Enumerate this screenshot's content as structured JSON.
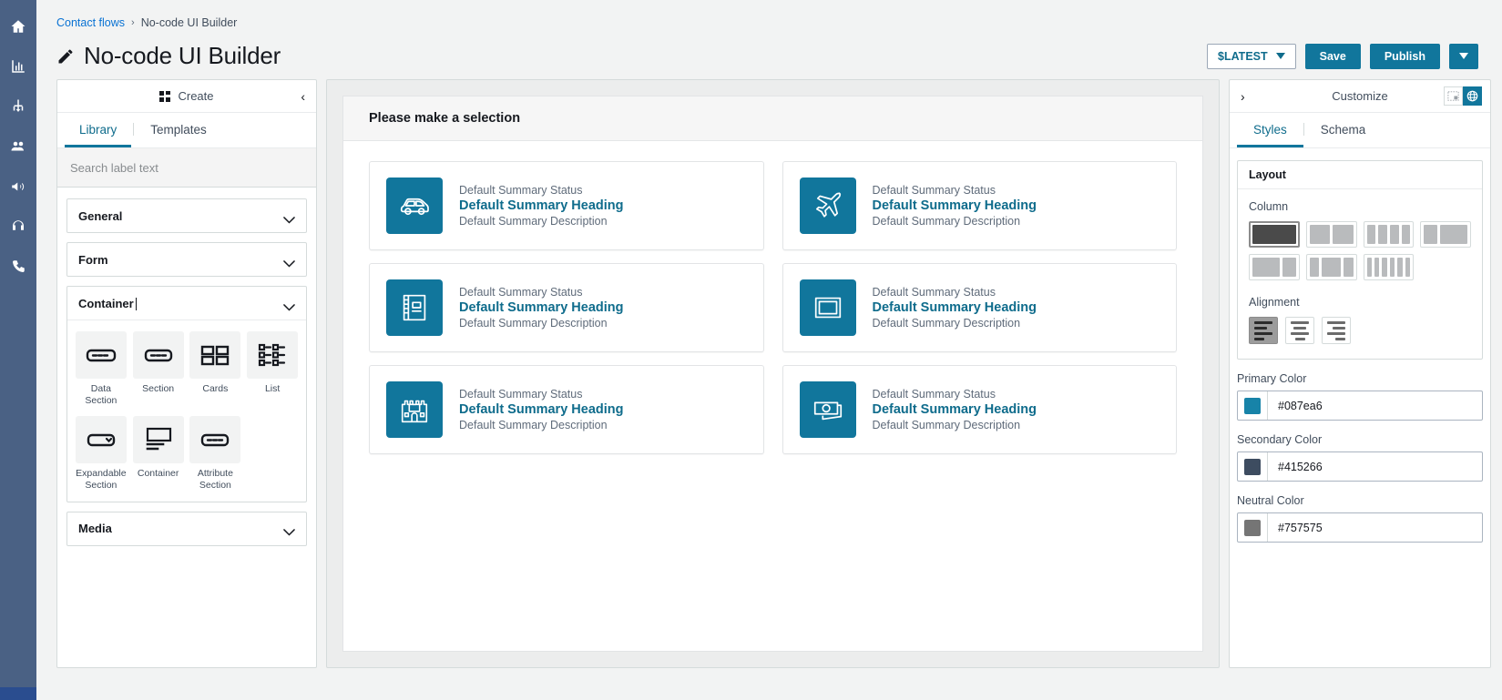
{
  "rail": {
    "items": [
      {
        "name": "home-icon",
        "label": "Home"
      },
      {
        "name": "analytics-icon",
        "label": "Analytics"
      },
      {
        "name": "routing-icon",
        "label": "Routing"
      },
      {
        "name": "users-icon",
        "label": "Users"
      },
      {
        "name": "campaign-icon",
        "label": "Campaigns"
      },
      {
        "name": "headset-icon",
        "label": "Agent workspace"
      },
      {
        "name": "phone-icon",
        "label": "Channels"
      }
    ]
  },
  "header": {
    "breadcrumb": {
      "parent": "Contact flows",
      "separator": "›",
      "current": "No-code UI Builder"
    },
    "title": "No-code UI Builder",
    "version_label": "$LATEST",
    "save_label": "Save",
    "publish_label": "Publish"
  },
  "library": {
    "panel_title": "Create",
    "collapse_icon": "‹",
    "tabs": [
      {
        "label": "Library",
        "active": true
      },
      {
        "label": "Templates",
        "active": false
      }
    ],
    "search": {
      "value": "",
      "placeholder": "Search label text"
    },
    "sections": [
      {
        "label": "General",
        "expanded": false
      },
      {
        "label": "Form",
        "expanded": false
      },
      {
        "label": "Container",
        "expanded": true
      },
      {
        "label": "Media",
        "expanded": false
      }
    ],
    "container_tiles": [
      {
        "label": "Data Section",
        "icon": "data-section-icon"
      },
      {
        "label": "Section",
        "icon": "section-icon"
      },
      {
        "label": "Cards",
        "icon": "cards-icon"
      },
      {
        "label": "List",
        "icon": "list-icon"
      },
      {
        "label": "Expandable Section",
        "icon": "expandable-section-icon"
      },
      {
        "label": "Container",
        "icon": "container-icon"
      },
      {
        "label": "Attribute Section",
        "icon": "attribute-section-icon"
      }
    ]
  },
  "canvas": {
    "selection_title": "Please make a selection",
    "cards": [
      {
        "status": "Default Summary Status",
        "heading": "Default Summary Heading",
        "description": "Default Summary Description",
        "icon": "car-icon"
      },
      {
        "status": "Default Summary Status",
        "heading": "Default Summary Heading",
        "description": "Default Summary Description",
        "icon": "airplane-icon"
      },
      {
        "status": "Default Summary Status",
        "heading": "Default Summary Heading",
        "description": "Default Summary Description",
        "icon": "notebook-icon"
      },
      {
        "status": "Default Summary Status",
        "heading": "Default Summary Heading",
        "description": "Default Summary Description",
        "icon": "window-icon"
      },
      {
        "status": "Default Summary Status",
        "heading": "Default Summary Heading",
        "description": "Default Summary Description",
        "icon": "castle-icon"
      },
      {
        "status": "Default Summary Status",
        "heading": "Default Summary Heading",
        "description": "Default Summary Description",
        "icon": "money-icon"
      }
    ]
  },
  "customize": {
    "panel_title": "Customize",
    "expand_icon": "›",
    "view_toggles": [
      {
        "name": "device-preview-icon",
        "active": false
      },
      {
        "name": "globe-icon",
        "active": true
      }
    ],
    "tabs": [
      {
        "label": "Styles",
        "active": true
      },
      {
        "label": "Schema",
        "active": false
      }
    ],
    "layout": {
      "section_title": "Layout",
      "column_label": "Column",
      "column_options": [
        {
          "name": "column-1",
          "weights": [
            1
          ],
          "active": true
        },
        {
          "name": "column-2-even",
          "weights": [
            1,
            1
          ],
          "active": false
        },
        {
          "name": "column-4-even",
          "weights": [
            1,
            1,
            1,
            1
          ],
          "active": false
        },
        {
          "name": "column-2-wide-right",
          "weights": [
            1,
            2
          ],
          "active": false
        },
        {
          "name": "column-2-wide-left",
          "weights": [
            2,
            1
          ],
          "active": false
        },
        {
          "name": "column-3-center",
          "weights": [
            1,
            2,
            1
          ],
          "active": false
        },
        {
          "name": "column-6-even",
          "weights": [
            1,
            1,
            1,
            1,
            1,
            1
          ],
          "active": false
        }
      ],
      "alignment_label": "Alignment",
      "alignment_options": [
        {
          "name": "align-left",
          "active": true
        },
        {
          "name": "align-center",
          "active": false
        },
        {
          "name": "align-right",
          "active": false
        }
      ]
    },
    "colors": [
      {
        "label": "Primary Color",
        "value": "#087ea6",
        "swatch": "#1783a8"
      },
      {
        "label": "Secondary Color",
        "value": "#415266",
        "swatch": "#3d4c60"
      },
      {
        "label": "Neutral Color",
        "value": "#757575",
        "swatch": "#757575"
      }
    ]
  }
}
